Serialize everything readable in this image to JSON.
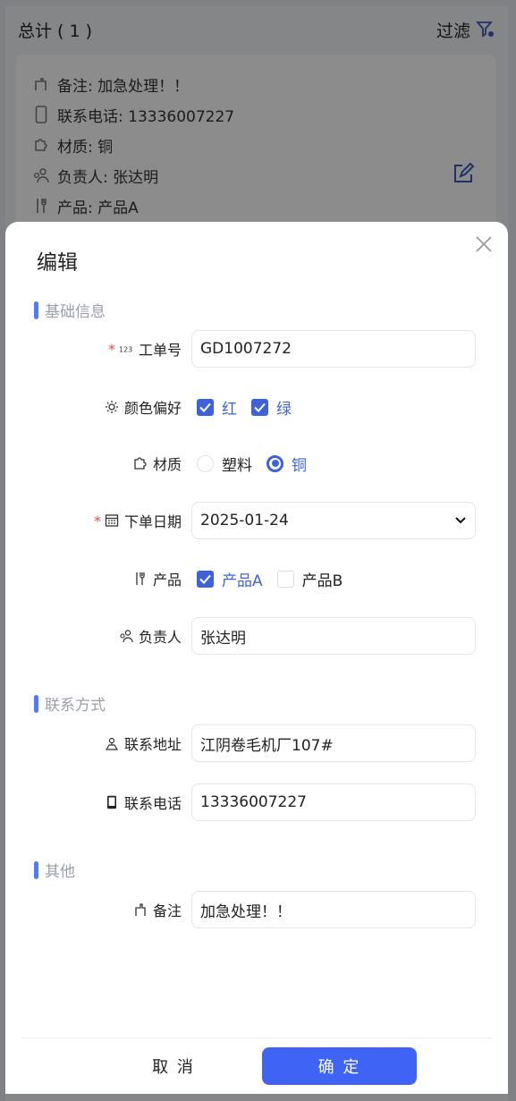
{
  "background": {
    "title": "总计 ( 1 )",
    "filter_label": "过滤",
    "card": {
      "remark": "备注: 加急处理！！",
      "phone": "联系电话: 13336007227",
      "material": "材质: 铜",
      "owner": "负责人: 张达明",
      "product": "产品: 产品A"
    }
  },
  "modal": {
    "title": "编辑",
    "sections": {
      "basic": "基础信息",
      "contact": "联系方式",
      "other": "其他"
    },
    "fields": {
      "order_no": {
        "label": "工单号",
        "value": "GD1007272",
        "required": true
      },
      "color": {
        "label": "颜色偏好",
        "options": [
          "红",
          "绿"
        ],
        "checked": [
          true,
          true
        ]
      },
      "material": {
        "label": "材质",
        "options": [
          "塑料",
          "铜"
        ],
        "selected": "铜"
      },
      "order_date": {
        "label": "下单日期",
        "value": "2025-01-24",
        "required": true
      },
      "product": {
        "label": "产品",
        "options": [
          "产品A",
          "产品B"
        ],
        "checked": [
          true,
          false
        ]
      },
      "owner": {
        "label": "负责人",
        "value": "张达明"
      },
      "address": {
        "label": "联系地址",
        "value": "江阴卷毛机厂107#"
      },
      "phone": {
        "label": "联系电话",
        "value": "13336007227"
      },
      "remark": {
        "label": "备注",
        "value": "加急处理！！"
      }
    },
    "cancel_label": "取 消",
    "ok_label": "确 定"
  },
  "colors": {
    "accent": "#3f63f5",
    "required": "#e24b4b",
    "section_bar": "#4f7cf5"
  }
}
